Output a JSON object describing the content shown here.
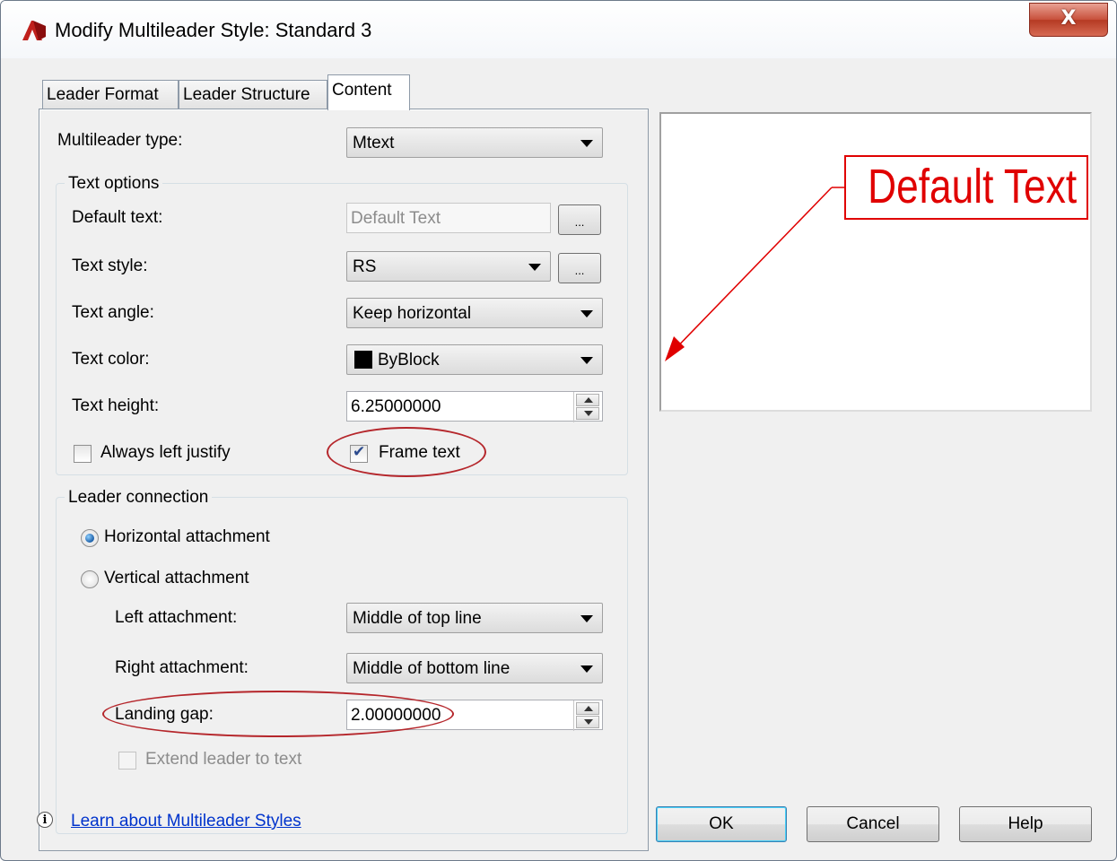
{
  "window": {
    "title": "Modify Multileader Style: Standard 3",
    "close_glyph": "X"
  },
  "tabs": [
    {
      "label": "Leader Format"
    },
    {
      "label": "Leader Structure"
    },
    {
      "label": "Content",
      "active": true
    }
  ],
  "content": {
    "multileader_type": {
      "label": "Multileader type:",
      "value": "Mtext"
    },
    "text_options": {
      "legend": "Text options",
      "default_text": {
        "label": "Default text:",
        "value": "Default Text",
        "browse": "..."
      },
      "text_style": {
        "label": "Text style:",
        "value": "RS",
        "browse": "..."
      },
      "text_angle": {
        "label": "Text angle:",
        "value": "Keep horizontal"
      },
      "text_color": {
        "label": "Text color:",
        "value": "ByBlock",
        "swatch": "#000000"
      },
      "text_height": {
        "label": "Text height:",
        "value": "6.25000000"
      },
      "always_left_justify": {
        "label": "Always left justify",
        "checked": false
      },
      "frame_text": {
        "label": "Frame text",
        "checked": true
      }
    },
    "leader_connection": {
      "legend": "Leader connection",
      "horizontal": {
        "label": "Horizontal attachment",
        "selected": true
      },
      "vertical": {
        "label": "Vertical attachment",
        "selected": false
      },
      "left_attachment": {
        "label": "Left attachment:",
        "value": "Middle of top line"
      },
      "right_attachment": {
        "label": "Right attachment:",
        "value": "Middle of bottom line"
      },
      "landing_gap": {
        "label": "Landing gap:",
        "value": "2.00000000"
      },
      "extend_leader": {
        "label": "Extend leader to text",
        "checked": false,
        "enabled": false
      }
    }
  },
  "preview": {
    "text": "Default Text",
    "color": "#e00000"
  },
  "footer": {
    "info_glyph": "i",
    "link": "Learn about Multileader Styles",
    "ok": "OK",
    "cancel": "Cancel",
    "help": "Help"
  },
  "highlight_color": "#b5262b"
}
